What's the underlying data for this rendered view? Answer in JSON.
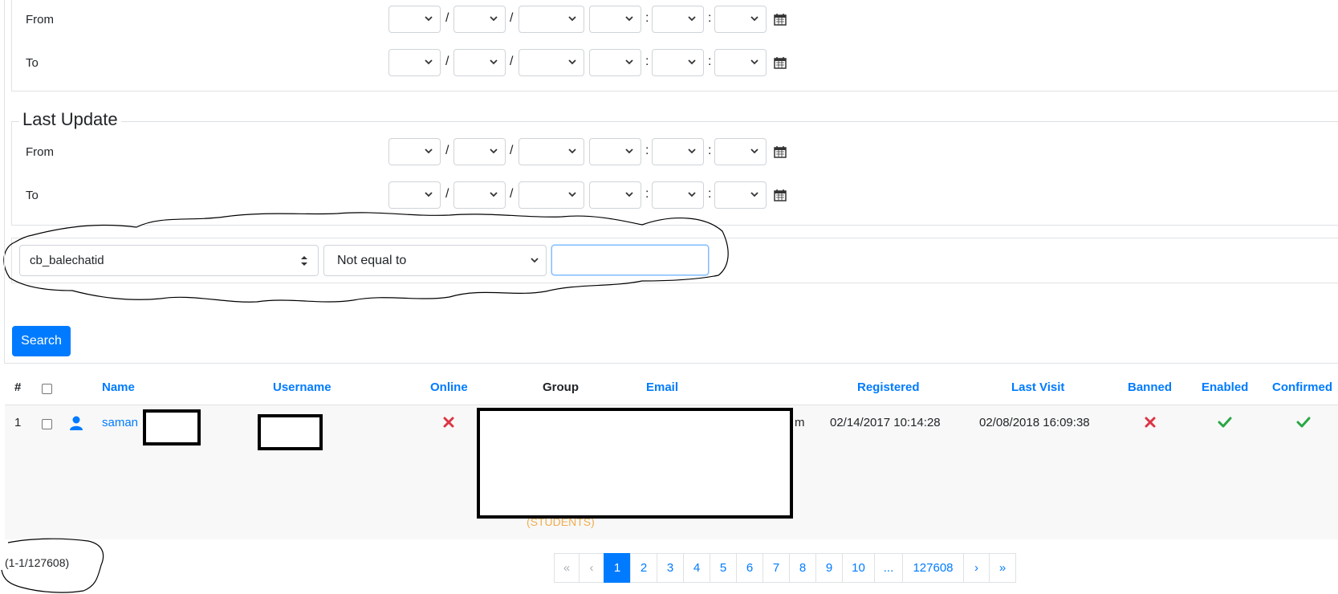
{
  "date_filters": [
    {
      "row_label": "From"
    },
    {
      "row_label": "To"
    }
  ],
  "last_update": {
    "legend": "Last Update",
    "from_label": "From",
    "to_label": "To"
  },
  "separators": {
    "slash": "/",
    "colon": ":"
  },
  "condition": {
    "field_value": "cb_balechatid",
    "operator_value": "Not equal to",
    "value_input": ""
  },
  "search_button": "Search",
  "table": {
    "headers": {
      "index": "#",
      "name": "Name",
      "username": "Username",
      "online": "Online",
      "group": "Group",
      "email": "Email",
      "registered": "Registered",
      "last_visit": "Last Visit",
      "banned": "Banned",
      "enabled": "Enabled",
      "confirmed": "Confirmed"
    },
    "rows": [
      {
        "index": "1",
        "name": "saman",
        "email_tail": "m",
        "registered": "02/14/2017 10:14:28",
        "last_visit": "02/08/2018 16:09:38",
        "group_label": "(STUDENTS)"
      }
    ]
  },
  "result_count": "(1-1/127608)",
  "pagination": {
    "first": "«",
    "prev": "‹",
    "pages": [
      "1",
      "2",
      "3",
      "4",
      "5",
      "6",
      "7",
      "8",
      "9",
      "10"
    ],
    "ellipsis": "...",
    "last_page": "127608",
    "next": "›",
    "last": "»"
  },
  "colors": {
    "primary": "#007bff",
    "danger": "#dc3545",
    "success": "#28a745",
    "group_label": "#f0ad4e"
  }
}
